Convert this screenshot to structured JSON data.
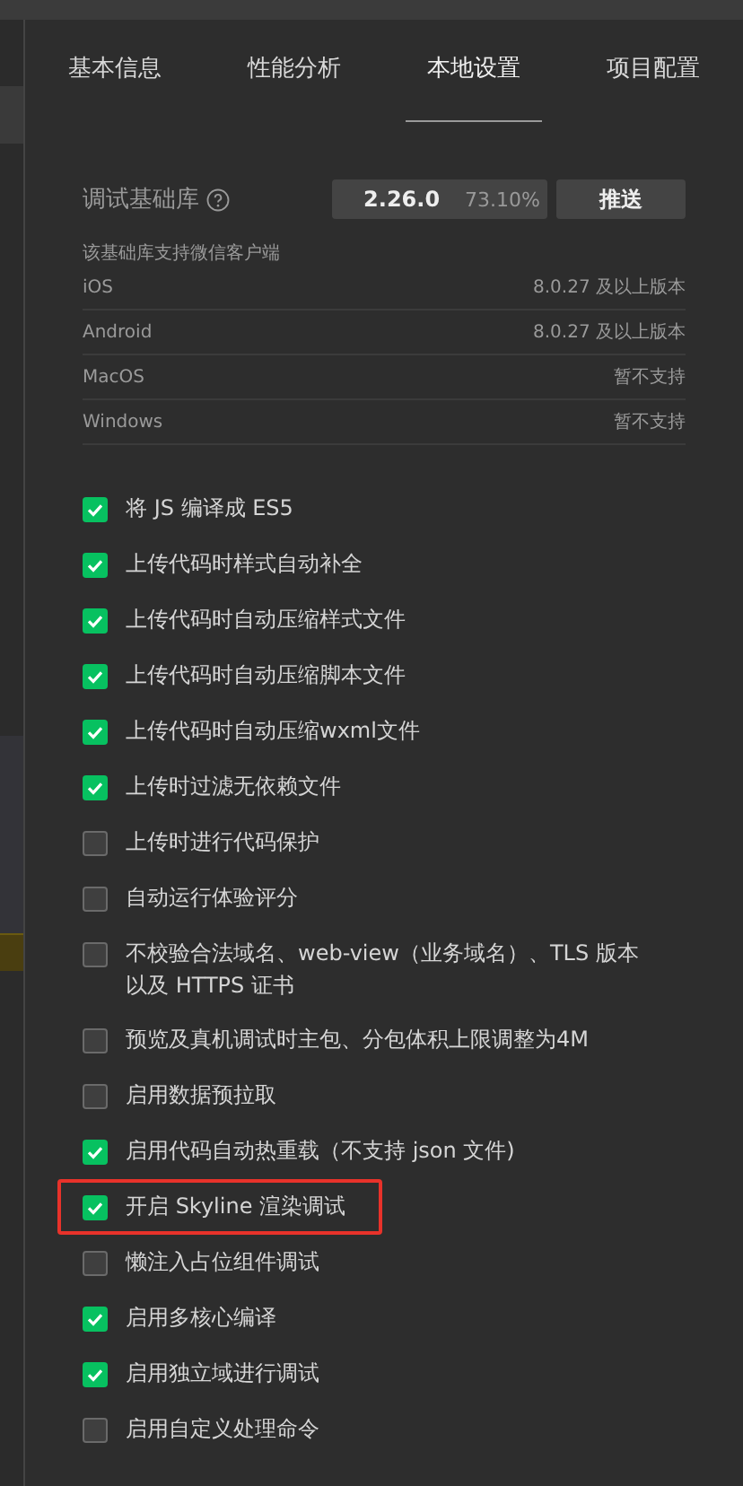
{
  "tabs": [
    {
      "label": "基本信息",
      "selected": false
    },
    {
      "label": "性能分析",
      "selected": false
    },
    {
      "label": "本地设置",
      "selected": true
    },
    {
      "label": "项目配置",
      "selected": false
    }
  ],
  "debug_library": {
    "label": "调试基础库",
    "version": "2.26.0",
    "share": "73.10%",
    "button": "推送"
  },
  "client_support": {
    "title": "该基础库支持微信客户端",
    "rows": [
      {
        "platform": "iOS",
        "requirement": "8.0.27 及以上版本"
      },
      {
        "platform": "Android",
        "requirement": "8.0.27 及以上版本"
      },
      {
        "platform": "MacOS",
        "requirement": "暂不支持"
      },
      {
        "platform": "Windows",
        "requirement": "暂不支持"
      }
    ]
  },
  "options": [
    {
      "label": "将 JS 编译成 ES5",
      "checked": true,
      "highlighted": false
    },
    {
      "label": "上传代码时样式自动补全",
      "checked": true,
      "highlighted": false
    },
    {
      "label": "上传代码时自动压缩样式文件",
      "checked": true,
      "highlighted": false
    },
    {
      "label": "上传代码时自动压缩脚本文件",
      "checked": true,
      "highlighted": false
    },
    {
      "label": "上传代码时自动压缩wxml文件",
      "checked": true,
      "highlighted": false
    },
    {
      "label": "上传时过滤无依赖文件",
      "checked": true,
      "highlighted": false
    },
    {
      "label": "上传时进行代码保护",
      "checked": false,
      "highlighted": false
    },
    {
      "label": "自动运行体验评分",
      "checked": false,
      "highlighted": false
    },
    {
      "label": "不校验合法域名、web-view（业务域名）、TLS 版本以及 HTTPS 证书",
      "checked": false,
      "highlighted": false
    },
    {
      "label": "预览及真机调试时主包、分包体积上限调整为4M",
      "checked": false,
      "highlighted": false
    },
    {
      "label": "启用数据预拉取",
      "checked": false,
      "highlighted": false
    },
    {
      "label": "启用代码自动热重载（不支持 json 文件)",
      "checked": true,
      "highlighted": false
    },
    {
      "label": "开启 Skyline 渲染调试",
      "checked": true,
      "highlighted": true
    },
    {
      "label": "懒注入占位组件调试",
      "checked": false,
      "highlighted": false
    },
    {
      "label": "启用多核心编译",
      "checked": true,
      "highlighted": false
    },
    {
      "label": "启用独立域进行调试",
      "checked": true,
      "highlighted": false
    },
    {
      "label": "启用自定义处理命令",
      "checked": false,
      "highlighted": false
    }
  ]
}
